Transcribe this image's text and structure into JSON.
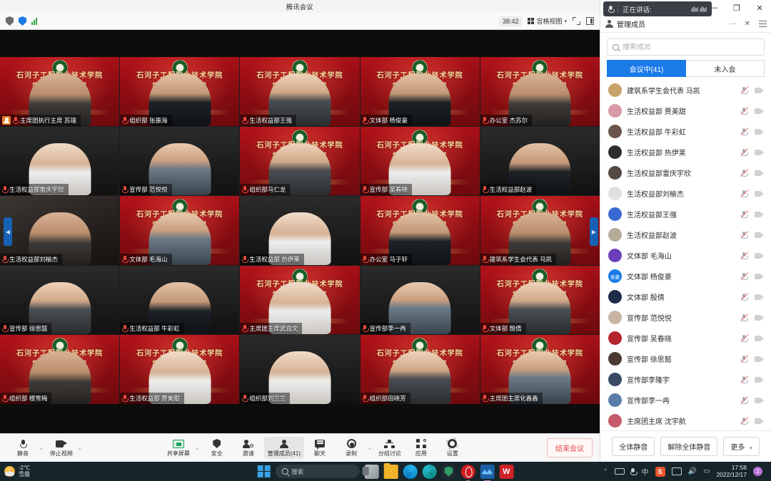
{
  "app": {
    "window_title": "腾讯会议",
    "timer": "38:42",
    "view_mode": "宫格视图"
  },
  "speaking_bar": {
    "label": "正在讲话:",
    "mic_icon": "microphone-icon",
    "wave_icon": "audio-wave-icon"
  },
  "window_controls": {
    "minimize": "—",
    "maximize": "❐",
    "close": "✕"
  },
  "grid": {
    "nav_prev": "◀",
    "nav_next": "▶",
    "tiles": [
      {
        "name": "主席团执行主席 苏瑞",
        "bg": "bg-banner",
        "tone": "ptone-1",
        "host": true,
        "banner": true,
        "line1": "石河子工程职业技术学院",
        "line2": "学生会第十七届"
      },
      {
        "name": "组织部 张振海",
        "bg": "bg-banner",
        "tone": "ptone-2",
        "host": false,
        "banner": true,
        "line1": "石河子工程职业技术学院",
        "line2": "学生会第十七届"
      },
      {
        "name": "生活权益部王强",
        "bg": "bg-banner",
        "tone": "ptone-3",
        "host": false,
        "banner": true,
        "line1": "石河子工程职业技术学院",
        "line2": "学生会第十七届"
      },
      {
        "name": "文体部 杨俊豪",
        "bg": "bg-banner",
        "tone": "ptone-2",
        "host": false,
        "banner": true,
        "line1": "石河子工程职业技术学院",
        "line2": "学生会第十七届"
      },
      {
        "name": "办公室 杰苏尔",
        "bg": "bg-banner",
        "tone": "ptone-1",
        "host": false,
        "banner": true,
        "line1": "石河子工程职业技术学院",
        "line2": "学生会第十七届"
      },
      {
        "name": "生活权益部雷庆宇欣",
        "bg": "bg-dark",
        "tone": "ptone-5",
        "host": false,
        "banner": false,
        "line1": "",
        "line2": ""
      },
      {
        "name": "宣传部 范悦悦",
        "bg": "bg-dark",
        "tone": "ptone-4",
        "host": false,
        "banner": false,
        "line1": "",
        "line2": ""
      },
      {
        "name": "组织部马仁龙",
        "bg": "bg-banner",
        "tone": "ptone-3",
        "host": false,
        "banner": true,
        "line1": "石河子工程职业技术学院",
        "line2": "学生会第十七届"
      },
      {
        "name": "宣传部 吴春晓",
        "bg": "bg-banner",
        "tone": "ptone-5",
        "host": false,
        "banner": true,
        "line1": "石河子工程职业技术学院",
        "line2": "学生会第十七届"
      },
      {
        "name": "生活权益部赵波",
        "bg": "bg-dark",
        "tone": "ptone-2",
        "host": false,
        "banner": false,
        "line1": "",
        "line2": ""
      },
      {
        "name": "生活权益部刘榆杰",
        "bg": "bg-room",
        "tone": "ptone-1",
        "host": false,
        "banner": false,
        "line1": "",
        "line2": ""
      },
      {
        "name": "文体部 毛海山",
        "bg": "bg-banner",
        "tone": "ptone-4",
        "host": false,
        "banner": true,
        "line1": "石河子工程职业技术学院",
        "line2": "学生会第十七届"
      },
      {
        "name": "生活权益部 热伊莱",
        "bg": "bg-dark",
        "tone": "ptone-5",
        "host": false,
        "banner": false,
        "line1": "",
        "line2": ""
      },
      {
        "name": "办公室 马子轩",
        "bg": "bg-banner",
        "tone": "ptone-2",
        "host": false,
        "banner": true,
        "line1": "石河子工程职业技术学院",
        "line2": "学生会第十七届"
      },
      {
        "name": "建筑系学生会代表 马凯",
        "bg": "bg-banner",
        "tone": "ptone-1",
        "host": false,
        "banner": true,
        "line1": "石河子工程职业技术学院",
        "line2": "学生会第十七届"
      },
      {
        "name": "宣传部 徐思懿",
        "bg": "bg-dark",
        "tone": "ptone-3",
        "host": false,
        "banner": false,
        "line1": "",
        "line2": ""
      },
      {
        "name": "生活权益部 牛彩虹",
        "bg": "bg-dark",
        "tone": "ptone-2",
        "host": false,
        "banner": false,
        "line1": "",
        "line2": ""
      },
      {
        "name": "主席团主席武自文",
        "bg": "bg-banner",
        "tone": "ptone-5",
        "host": false,
        "banner": true,
        "line1": "石河子工程职业技术学院",
        "line2": "学生会第十七届"
      },
      {
        "name": "宣传部李一冉",
        "bg": "bg-dark",
        "tone": "ptone-4",
        "host": false,
        "banner": false,
        "line1": "",
        "line2": ""
      },
      {
        "name": "文体部 殷倩",
        "bg": "bg-banner",
        "tone": "ptone-3",
        "host": false,
        "banner": true,
        "line1": "石河子工程职业技术学院",
        "line2": "学生会第十七届"
      },
      {
        "name": "组织部 檀雪梅",
        "bg": "bg-banner",
        "tone": "ptone-1",
        "host": false,
        "banner": true,
        "line1": "石河子工程职业技术学院",
        "line2": "学生会第十七届"
      },
      {
        "name": "生活权益部 贾美甜",
        "bg": "bg-banner",
        "tone": "ptone-5",
        "host": false,
        "banner": true,
        "line1": "石河子工程职业技术学院",
        "line2": "学生会第十七届"
      },
      {
        "name": "组织部刘兰兰",
        "bg": "bg-dark",
        "tone": "ptone-5",
        "host": false,
        "banner": false,
        "line1": "",
        "line2": ""
      },
      {
        "name": "组织部田晓芳",
        "bg": "bg-banner",
        "tone": "ptone-3",
        "host": false,
        "banner": true,
        "line1": "石河子工程职业技术学院",
        "line2": "学生会第十七届"
      },
      {
        "name": "主席团主席化鑫鑫",
        "bg": "bg-banner",
        "tone": "ptone-4",
        "host": false,
        "banner": true,
        "line1": "石河子工程职业技术学院",
        "line2": "学生会第十七届"
      }
    ]
  },
  "bottom_toolbar": {
    "items": [
      {
        "label": "静音",
        "icon": "microphone-icon",
        "caret": true,
        "active": false
      },
      {
        "label": "停止视频",
        "icon": "camera-icon",
        "caret": true,
        "active": false
      },
      {
        "label": "共享屏幕",
        "icon": "share-screen-icon",
        "caret": true,
        "active": false
      },
      {
        "label": "安全",
        "icon": "shield-icon",
        "caret": false,
        "active": false
      },
      {
        "label": "邀请",
        "icon": "invite-user-icon",
        "caret": false,
        "active": false
      },
      {
        "label": "管理成员(41)",
        "icon": "manage-members-icon",
        "caret": false,
        "active": true
      },
      {
        "label": "聊天",
        "icon": "chat-icon",
        "caret": false,
        "active": false
      },
      {
        "label": "录制",
        "icon": "record-icon",
        "caret": true,
        "active": false
      },
      {
        "label": "分组讨论",
        "icon": "breakout-icon",
        "caret": false,
        "active": false
      },
      {
        "label": "应用",
        "icon": "apps-icon",
        "caret": false,
        "active": false
      },
      {
        "label": "设置",
        "icon": "gear-icon",
        "caret": false,
        "active": false
      }
    ],
    "end_meeting": "结束会议"
  },
  "member_panel": {
    "title": "管理成员",
    "title_icon": "members-icon",
    "more_icon": "···",
    "close_icon": "✕",
    "menu_icon": "hamburger-icon",
    "search_placeholder": "搜索成员",
    "search_value": "",
    "tabs": [
      {
        "label": "会议中(41)",
        "active": true
      },
      {
        "label": "未入会",
        "active": false
      }
    ],
    "members": [
      {
        "name": "建筑系学生会代表 马凯",
        "avatar": "#c8a26b"
      },
      {
        "name": "生活权益部 贾美甜",
        "avatar": "#d79aa6"
      },
      {
        "name": "生活权益部 牛彩虹",
        "avatar": "#6b5449"
      },
      {
        "name": "生活权益部 热伊莱",
        "avatar": "#2d2d2d"
      },
      {
        "name": "生活权益部雷庆宇欣",
        "avatar": "#544a43"
      },
      {
        "name": "生活权益部刘榆杰",
        "avatar": "#e2dfe0"
      },
      {
        "name": "生活权益部王强",
        "avatar": "#3a6ad1"
      },
      {
        "name": "生活权益部赵波",
        "avatar": "#b5ab99"
      },
      {
        "name": "文体部 毛海山",
        "avatar": "#6b3fb8"
      },
      {
        "name": "文体部 杨俊豪",
        "avatar": "#1a7ae8",
        "initials": "俊豪"
      },
      {
        "name": "文体部 殷倩",
        "avatar": "#1e2b4a"
      },
      {
        "name": "宣传部 范悦悦",
        "avatar": "#c8b5a4"
      },
      {
        "name": "宣传部 吴春晓",
        "avatar": "#b3242c"
      },
      {
        "name": "宣传部 徐思懿",
        "avatar": "#4a3a32"
      },
      {
        "name": "宣传部李隆宇",
        "avatar": "#3a4a63"
      },
      {
        "name": "宣传部李一冉",
        "avatar": "#5a7ca8"
      },
      {
        "name": "主席团主席 沈宇航",
        "avatar": "#c45a6a"
      },
      {
        "name": "主席团主席化鑫鑫",
        "avatar": "#8fae8a"
      },
      {
        "name": "主席团主席武自文",
        "avatar": "#2f5aa8"
      }
    ],
    "footer": {
      "mute_all": "全体静音",
      "unmute_all": "解除全体静音",
      "more": "更多",
      "more_caret": "▾"
    },
    "row_icons": {
      "mic": "mic-muted-icon",
      "cam": "camera-icon"
    }
  },
  "taskbar": {
    "weather": {
      "temp": "-2℃",
      "desc": "雪霾",
      "icon": "weather-snow-icon"
    },
    "start_icon": "windows-start-icon",
    "search_text": "搜索",
    "search_icon": "search-icon",
    "apps": [
      {
        "name": "task-view-icon",
        "running": false
      },
      {
        "name": "file-explorer-icon",
        "running": false
      },
      {
        "name": "edge-icon",
        "running": false
      },
      {
        "name": "browser-icon",
        "running": false
      },
      {
        "name": "security-icon",
        "running": false
      },
      {
        "name": "netease-music-icon",
        "running": true
      },
      {
        "name": "tencent-meeting-icon",
        "running": true
      },
      {
        "name": "wps-icon",
        "running": true,
        "glyph": "W"
      }
    ],
    "tray": {
      "overflow": "⌃",
      "keyboard_icon": "keyboard-icon",
      "mic_icon": "microphone-icon",
      "ime": "中",
      "snip_icon": "snipaste-icon",
      "snip_glyph": "S",
      "monitor_icon": "display-icon",
      "volume_icon": "🔊",
      "battery_icon": "battery-icon",
      "time": "17:58",
      "date": "2022/12/17",
      "notification_count": "2"
    }
  }
}
